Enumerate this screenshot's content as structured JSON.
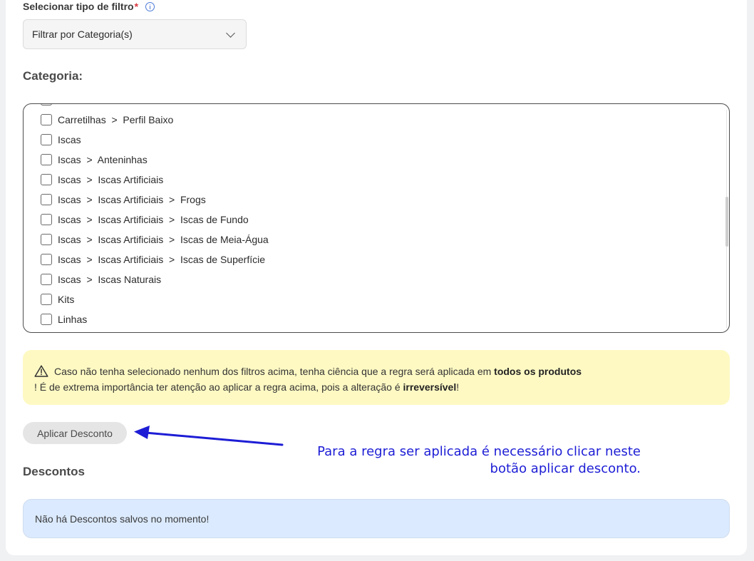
{
  "filter": {
    "label": "Selecionar tipo de filtro",
    "required_mark": "*",
    "selected_value": "Filtrar por Categoria(s)"
  },
  "category": {
    "heading": "Categoria:",
    "items": [
      "",
      "Carretilhas  >  Perfil Baixo",
      "Iscas",
      "Iscas  >  Anteninhas",
      "Iscas  >  Iscas Artificiais",
      "Iscas  >  Iscas Artificiais  >  Frogs",
      "Iscas  >  Iscas Artificiais  >  Iscas de Fundo",
      "Iscas  >  Iscas Artificiais  >  Iscas de Meia-Água",
      "Iscas  >  Iscas Artificiais  >  Iscas de Superfície",
      "Iscas  >  Iscas Naturais",
      "Kits",
      "Linhas"
    ]
  },
  "warning": {
    "text_1": "Caso não tenha selecionado nenhum dos filtros acima, tenha ciência que a regra será aplicada em ",
    "bold_1": "todos os produtos",
    "text_2": "! É de extrema importância ter atenção ao aplicar a regra acima, pois a alteração é ",
    "bold_2": "irreversível",
    "text_3": "!"
  },
  "apply_button": {
    "label": "Aplicar Desconto"
  },
  "annotation": {
    "line_1": "Para a regra ser aplicada é necessário clicar neste",
    "line_2": "botão aplicar desconto."
  },
  "discounts": {
    "heading": "Descontos",
    "empty_message": "Não há Descontos salvos no momento!"
  },
  "colors": {
    "warning_bg": "#fef9c3",
    "info_bg": "#dbeafe",
    "annotation_blue": "#1d1dd6",
    "required_red": "#d9363e"
  }
}
